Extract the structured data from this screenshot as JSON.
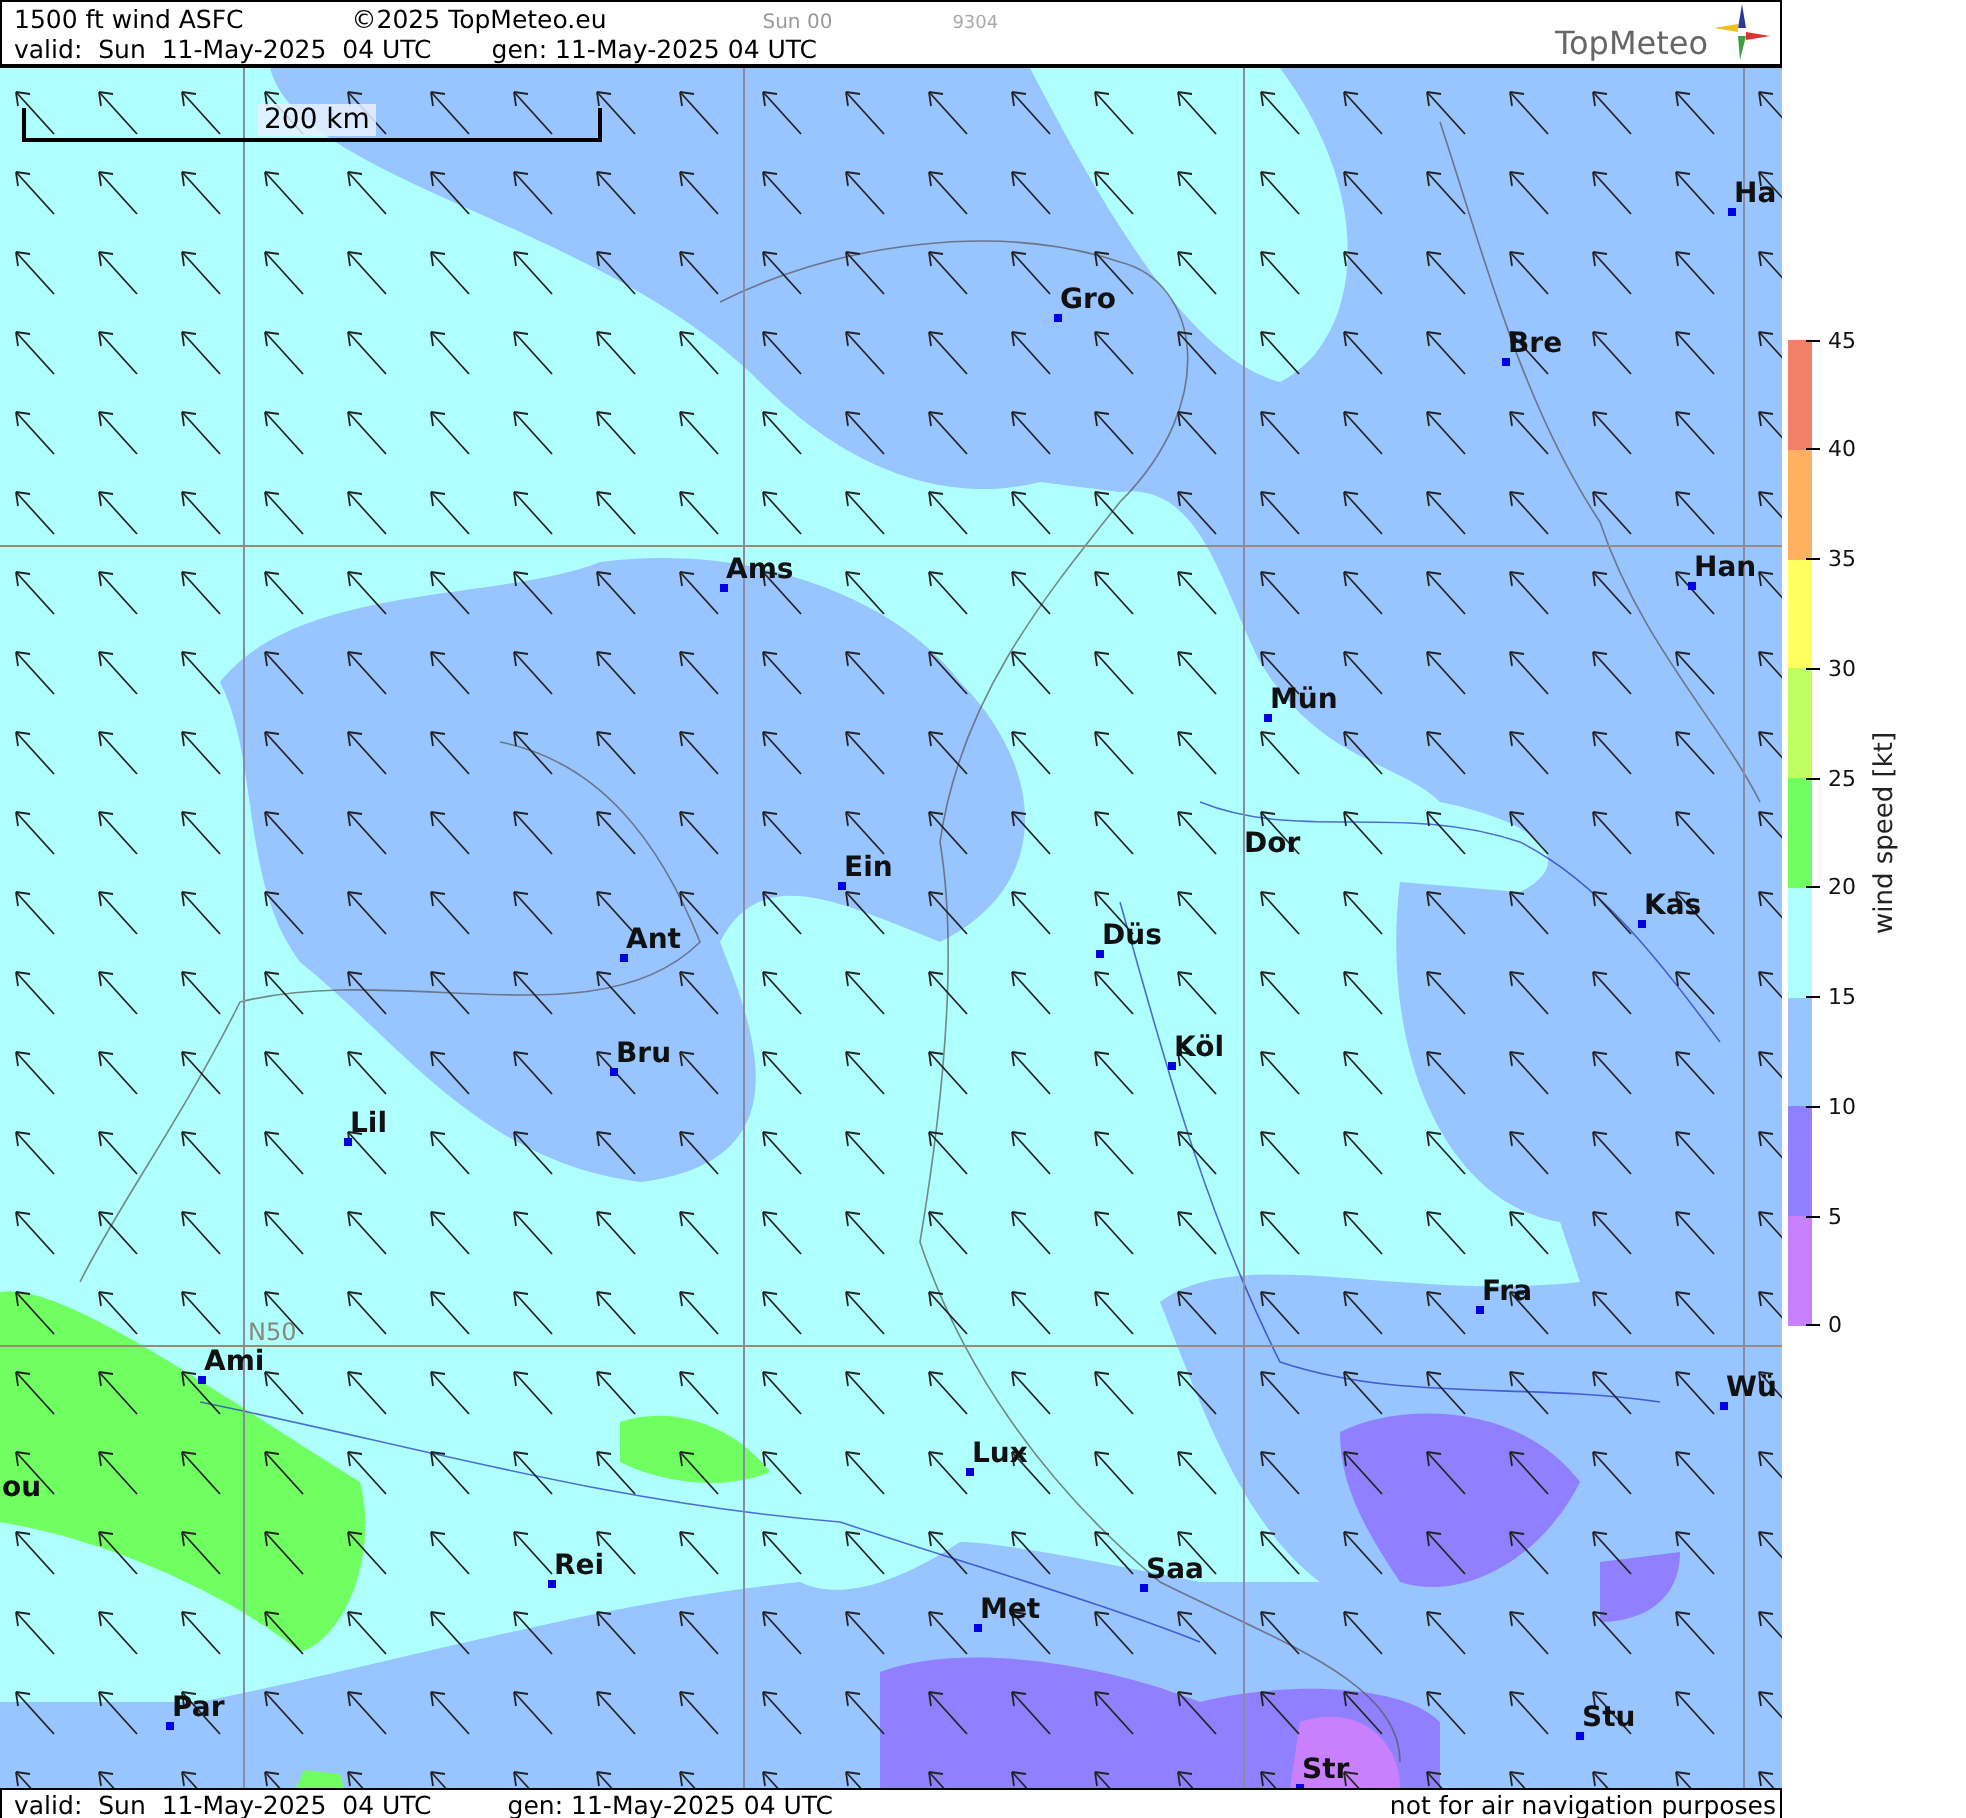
{
  "header": {
    "title": "1500 ft wind ASFC",
    "copyright": "©2025 TopMeteo.eu",
    "run": "Sun 00",
    "code": "9304",
    "valid": "valid:  Sun  11-May-2025  04 UTC",
    "generated": "gen: 11-May-2025 04 UTC",
    "logo": "TopMeteo"
  },
  "map": {
    "scale": "200 km",
    "latitude_label": "N50",
    "cities": [
      "Ha",
      "Gro",
      "Bre",
      "Ams",
      "Han",
      "Mün",
      "Ein",
      "Dor",
      "Düs",
      "Kas",
      "Ant",
      "Bru",
      "Köl",
      "Lil",
      "Fra",
      "Ami",
      "Wü",
      "Lux",
      "ou",
      "Rei",
      "Saa",
      "Met",
      "Par",
      "Stu",
      "Str"
    ]
  },
  "legend": {
    "title": "wind speed [kt]",
    "ticks": [
      "45",
      "40",
      "35",
      "30",
      "25",
      "20",
      "15",
      "10",
      "5",
      "0"
    ],
    "bands": [
      {
        "color": "#f08068"
      },
      {
        "color": "#ffb060"
      },
      {
        "color": "#ffff60"
      },
      {
        "color": "#c0ff60"
      },
      {
        "color": "#70ff60"
      },
      {
        "color": "#b0ffff"
      },
      {
        "color": "#98c4ff"
      },
      {
        "color": "#9080ff"
      },
      {
        "color": "#c880ff"
      }
    ]
  },
  "footer": {
    "valid": "valid:  Sun  11-May-2025  04 UTC",
    "generated": "gen: 11-May-2025 04 UTC",
    "disclaimer": "not for air navigation purposes"
  }
}
